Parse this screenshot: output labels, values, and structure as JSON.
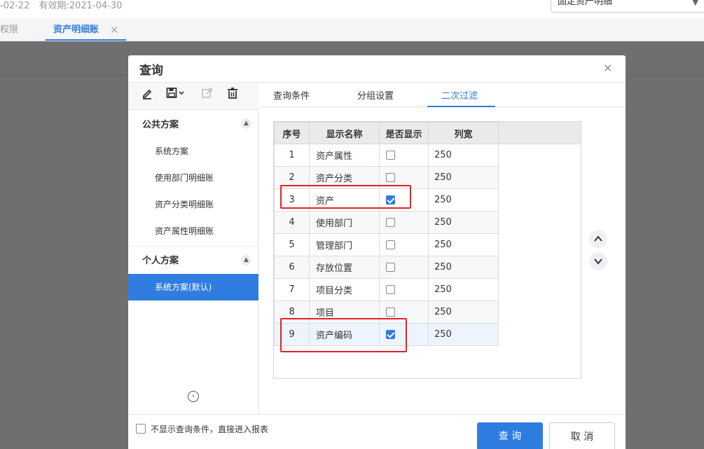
{
  "header": {
    "date_info": "-02-22　有效期:2021-04-30",
    "select_value": "固定资产明细",
    "tabs": [
      {
        "label": "权限"
      },
      {
        "label": "资产明细账"
      }
    ]
  },
  "dialog": {
    "title": "查询",
    "close_glyph": "×",
    "toolbar_icons": [
      "edit-icon",
      "save-icon",
      "export-icon",
      "delete-icon"
    ],
    "groups": [
      {
        "label": "公共方案",
        "items": [
          "系统方案",
          "使用部门明细账",
          "资产分类明细账",
          "资产属性明细账"
        ]
      },
      {
        "label": "个人方案",
        "items": [
          "系统方案(默认)"
        ]
      }
    ],
    "tabs": [
      {
        "label": "查询条件"
      },
      {
        "label": "分组设置"
      },
      {
        "label": "二次过滤"
      }
    ],
    "active_tab": "二次过滤",
    "grid": {
      "columns": [
        "序号",
        "显示名称",
        "是否显示",
        "列宽"
      ],
      "rows": [
        {
          "no": "1",
          "name": "资产属性",
          "show": false,
          "width": "250"
        },
        {
          "no": "2",
          "name": "资产分类",
          "show": false,
          "width": "250"
        },
        {
          "no": "3",
          "name": "资产",
          "show": true,
          "width": "250"
        },
        {
          "no": "4",
          "name": "使用部门",
          "show": false,
          "width": "250"
        },
        {
          "no": "5",
          "name": "管理部门",
          "show": false,
          "width": "250"
        },
        {
          "no": "6",
          "name": "存放位置",
          "show": false,
          "width": "250"
        },
        {
          "no": "7",
          "name": "项目分类",
          "show": false,
          "width": "250"
        },
        {
          "no": "8",
          "name": "项目",
          "show": false,
          "width": "250"
        },
        {
          "no": "9",
          "name": "资产编码",
          "show": true,
          "width": "250"
        }
      ]
    },
    "footer": {
      "skip_label": "不显示查询条件，直接进入报表",
      "query_label": "查 询",
      "cancel_label": "取 消"
    },
    "colors": {
      "accent": "#2f7de1",
      "highlight": "#e52222"
    }
  }
}
